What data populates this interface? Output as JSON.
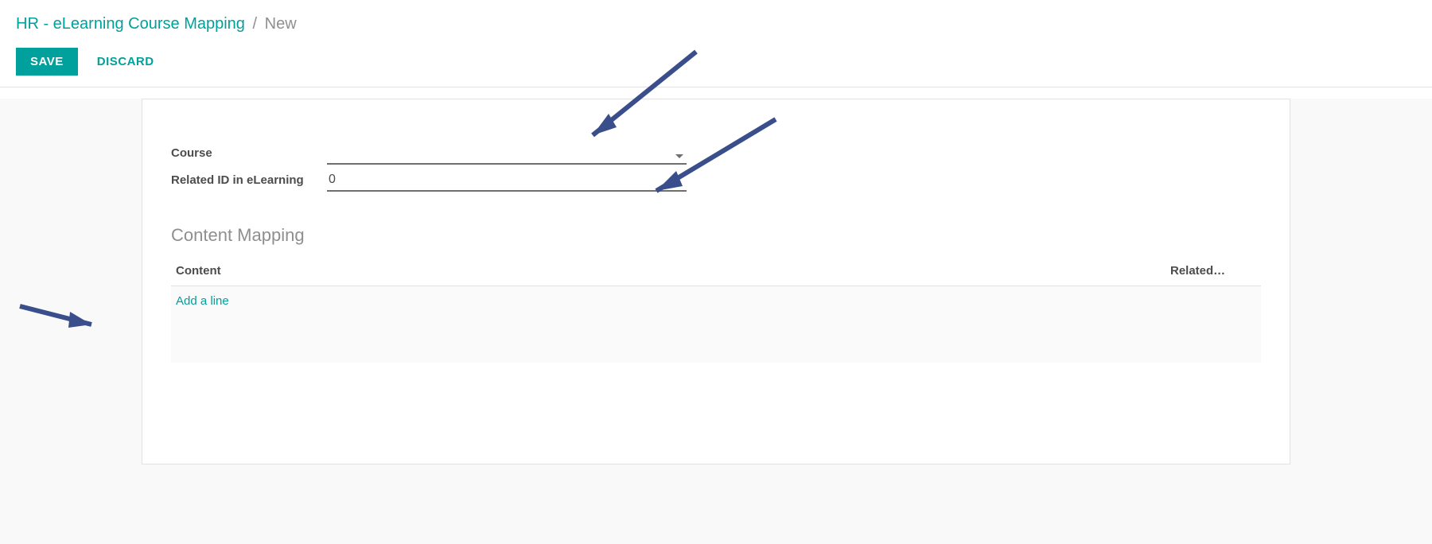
{
  "breadcrumb": {
    "parent": "HR - eLearning Course Mapping",
    "separator": "/",
    "current": "New"
  },
  "buttons": {
    "save": "SAVE",
    "discard": "DISCARD"
  },
  "form": {
    "course_label": "Course",
    "course_value": "",
    "related_id_label": "Related ID in eLearning",
    "related_id_value": "0"
  },
  "section": {
    "title": "Content Mapping"
  },
  "table": {
    "headers": {
      "content": "Content",
      "related": "Related…"
    },
    "add_line": "Add a line"
  }
}
